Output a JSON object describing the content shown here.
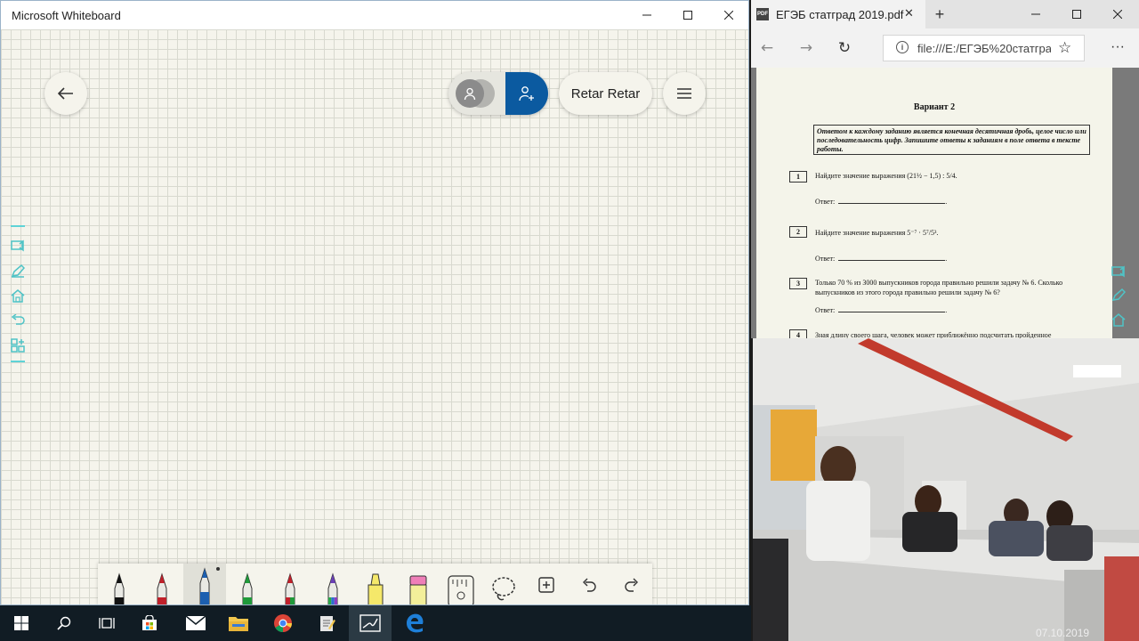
{
  "whiteboard": {
    "title": "Microsoft Whiteboard",
    "user_name": "Retar Retar",
    "toolbar_tools": [
      "black-pen",
      "red-pen",
      "blue-pen",
      "green-pen",
      "red-green-pen",
      "rainbow-pen",
      "highlighter",
      "eraser",
      "ruler",
      "lasso",
      "add",
      "undo",
      "redo"
    ],
    "selected_tool": "blue-pen",
    "colors": {
      "accent": "#0b5aa0",
      "canvas": "#f5f4ec",
      "grid": "#d8d9cf"
    }
  },
  "edge": {
    "tab_title": "ЕГЭБ статград 2019.pdf",
    "pdf_badge": "PDF",
    "url": "file:///E:/ЕГЭБ%20статгра,",
    "pdf": {
      "variant": "Вариант 2",
      "instructions": "Ответом к каждому заданию является конечная десятичная дробь, целое число или последовательность цифр. Запишите ответы к заданиям в поле ответа в тексте работы.",
      "answer_label": "Ответ:",
      "questions": [
        {
          "num": "1",
          "text": "Найдите значение выражения",
          "expr": "(21½ − 1,5) : 5/4."
        },
        {
          "num": "2",
          "text": "Найдите значение выражения",
          "expr": "5⁻⁷ · 5⁷/5³."
        },
        {
          "num": "3",
          "text": "Только 70 % из 3000 выпускников города правильно решили задачу № 6. Сколько выпускников из этого города правильно решили задачу № 6?",
          "expr": ""
        },
        {
          "num": "4",
          "text": "Зная длину своего шага, человек может приближённо подсчитать пройденное",
          "expr": ""
        }
      ]
    }
  },
  "webcam": {
    "date": "07.10.2019"
  },
  "taskbar": {
    "items": [
      "windows-start",
      "search",
      "task-view",
      "store",
      "mail",
      "file-explorer",
      "chrome",
      "notepad",
      "whiteboard",
      "edge"
    ],
    "active": "whiteboard"
  }
}
